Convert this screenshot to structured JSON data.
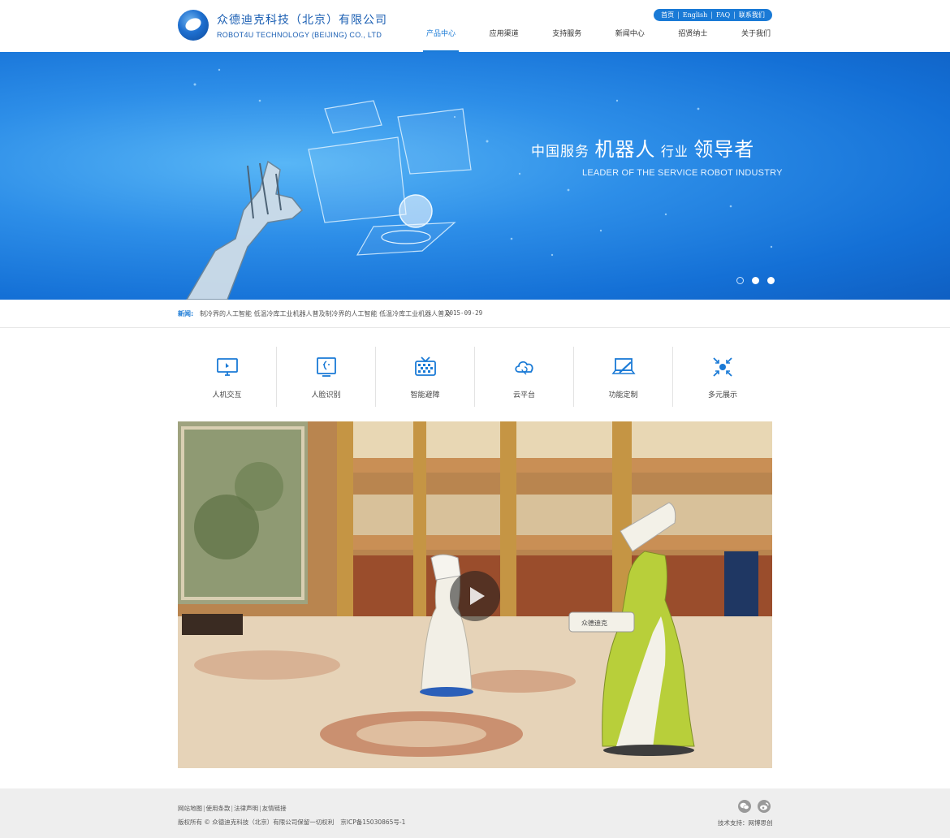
{
  "brand": {
    "name_cn": "众德迪克科技（北京）有限公司",
    "name_en": "ROBOT4U TECHNOLOGY (BEIJING) CO., LTD"
  },
  "top_links": [
    "首页",
    "English",
    "FAQ",
    "联系我们"
  ],
  "nav": {
    "items": [
      "产品中心",
      "应用渠道",
      "支持服务",
      "新闻中心",
      "招贤纳士",
      "关于我们"
    ],
    "active": "产品中心"
  },
  "banner": {
    "headline_1": "中国服务",
    "headline_2": "机器人",
    "headline_3": "行业",
    "headline_4": "领导者",
    "subtitle": "LEADER OF THE SERVICE ROBOT INDUSTRY",
    "slide_count": 3,
    "active_slide": 1
  },
  "news": {
    "label": "新闻:",
    "text": "制冷界的人工智能 低温冷库工业机器人普及制冷界的人工智能 低温冷库工业机器人普及",
    "date": "2015-09-29"
  },
  "features": [
    {
      "label": "人机交互",
      "icon": "monitor-touch-icon"
    },
    {
      "label": "人脸识别",
      "icon": "face-recognition-icon"
    },
    {
      "label": "智能避障",
      "icon": "obstacle-avoidance-icon"
    },
    {
      "label": "云平台",
      "icon": "cloud-icon"
    },
    {
      "label": "功能定制",
      "icon": "laptop-edit-icon"
    },
    {
      "label": "多元展示",
      "icon": "expand-arrows-icon"
    }
  ],
  "video": {
    "robot_text": "众德迪克"
  },
  "footer": {
    "links": [
      "网站地图",
      "使用条款",
      "法律声明",
      "友情链接"
    ],
    "copyright": "版权所有 © 众德迪克科技（北京）有限公司保留一切权利",
    "icp": "京ICP备15030865号-1",
    "tech_support": "技术支持：网博思创"
  },
  "colors": {
    "accent": "#1a7ad6",
    "banner_blue": "#1470d6",
    "footer_bg": "#eeeeee"
  }
}
